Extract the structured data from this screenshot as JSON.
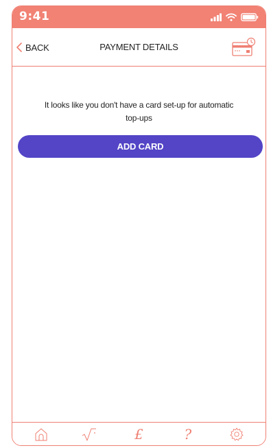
{
  "colors": {
    "accent": "#f18274",
    "border": "#ef7f72",
    "primary_button": "#5345c6",
    "text": "#222222"
  },
  "status_bar": {
    "time": "9:41",
    "icons": [
      "signal-icon",
      "wifi-icon",
      "battery-icon"
    ]
  },
  "header": {
    "back_label": "BACK",
    "title": "PAYMENT DETAILS",
    "right_icon": "credit-card-settings-icon"
  },
  "main": {
    "message": "It looks like you don't have a card set-up for automatic top-ups",
    "add_card_label": "ADD CARD"
  },
  "tab_bar": {
    "tabs": [
      {
        "name": "home",
        "icon": "home-icon"
      },
      {
        "name": "calculator",
        "icon": "square-root-icon"
      },
      {
        "name": "payments",
        "icon": "pound-icon",
        "glyph": "£"
      },
      {
        "name": "help",
        "icon": "question-icon",
        "glyph": "?"
      },
      {
        "name": "settings",
        "icon": "gear-icon"
      }
    ]
  }
}
